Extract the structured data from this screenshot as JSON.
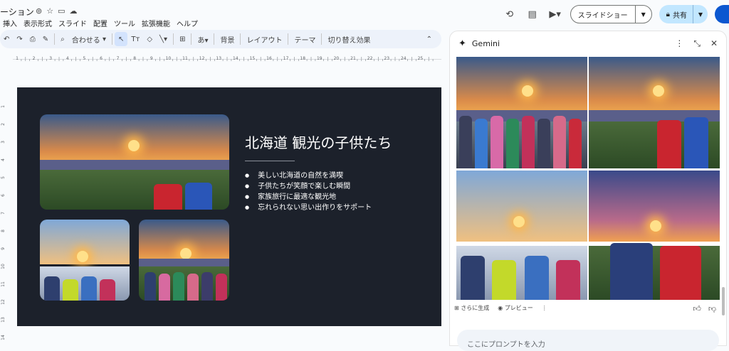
{
  "app": {
    "doc_title": "ーション",
    "menu": [
      "挿入",
      "表示形式",
      "スライド",
      "配置",
      "ツール",
      "拡張機能",
      "ヘルプ"
    ]
  },
  "header": {
    "slideshow_label": "スライドショー",
    "share_label": "共有"
  },
  "toolbar": {
    "zoom_label": "合わせる",
    "background_label": "背景",
    "layout_label": "レイアウト",
    "theme_label": "テーマ",
    "transition_label": "切り替え効果"
  },
  "slide": {
    "title": "北海道 観光の子供たち",
    "bullets": [
      "美しい北海道の自然を満喫",
      "子供たちが笑顔で楽しむ瞬間",
      "家族旅行に最適な観光地",
      "忘れられない思い出作りをサポート"
    ]
  },
  "ruler": {
    "h_ticks": [
      "1",
      "2",
      "3",
      "4",
      "5",
      "6",
      "7",
      "8",
      "9",
      "10",
      "11",
      "12",
      "13",
      "14",
      "15",
      "16",
      "17",
      "18",
      "19",
      "20",
      "21",
      "22",
      "23",
      "24",
      "25"
    ],
    "v_ticks": [
      "1",
      "2",
      "3",
      "4",
      "5",
      "6",
      "7",
      "8",
      "9",
      "10",
      "11",
      "12",
      "13",
      "14"
    ]
  },
  "gemini": {
    "title": "Gemini",
    "more_label": "さらに生成",
    "preview_label": "プレビュー",
    "prompt_placeholder": "ここにプロンプトを入力"
  },
  "colors": {
    "slide_bg": "#1c212b",
    "share_bg": "#c2e7ff",
    "accent": "#0b57d0"
  }
}
